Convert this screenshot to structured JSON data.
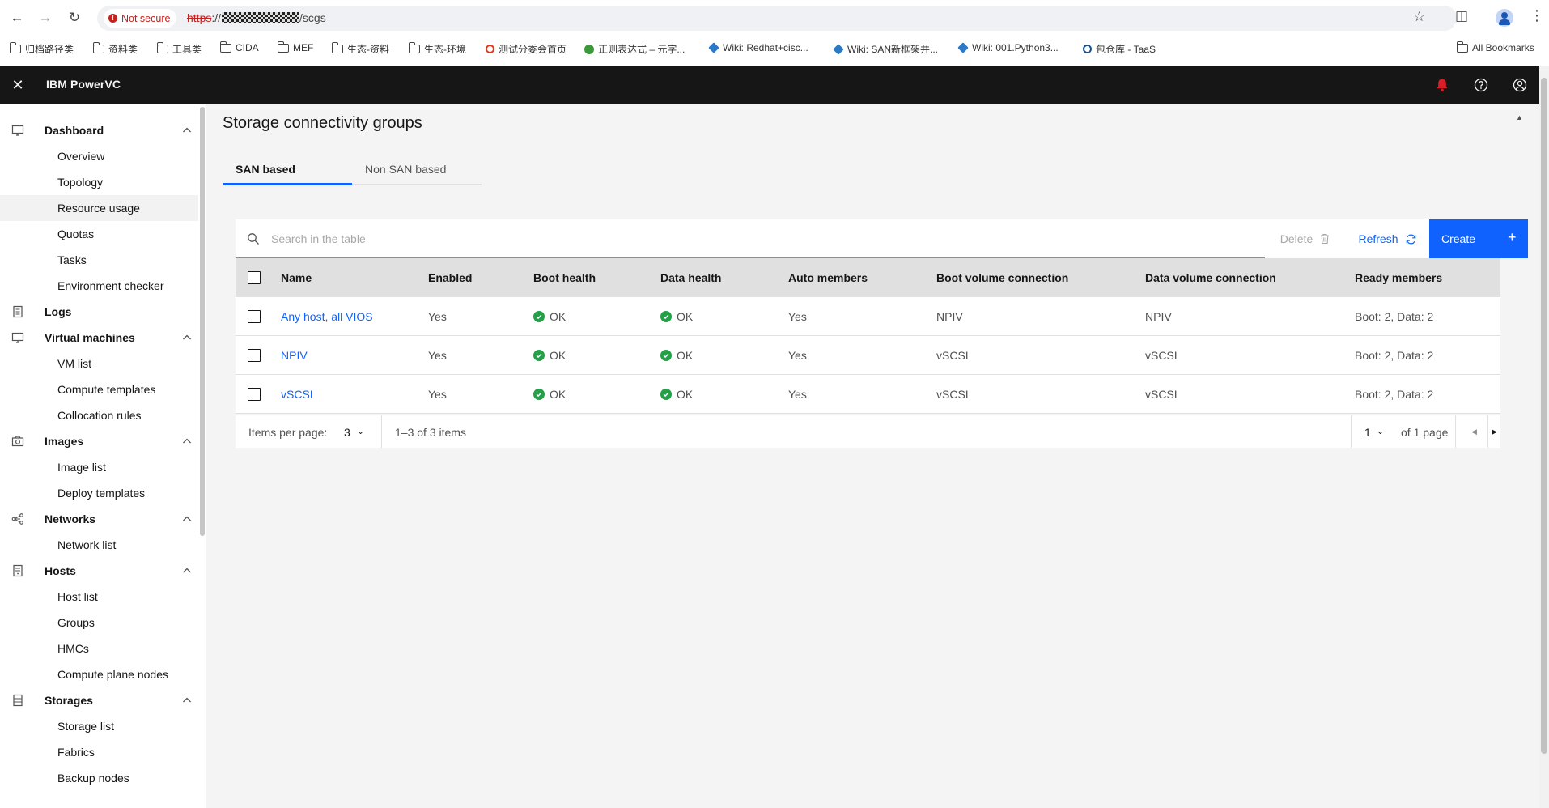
{
  "browser": {
    "not_secure": "Not secure",
    "url_scheme": "https",
    "url_sep": "://",
    "url_path": "/scgs",
    "bookmarks": [
      {
        "label": "归档路径类",
        "type": "folder"
      },
      {
        "label": "资料类",
        "type": "folder"
      },
      {
        "label": "工具类",
        "type": "folder"
      },
      {
        "label": "CIDA",
        "type": "folder"
      },
      {
        "label": "MEF",
        "type": "folder"
      },
      {
        "label": "生态-资料",
        "type": "folder"
      },
      {
        "label": "生态-环境",
        "type": "folder"
      },
      {
        "label": "测试分委会首页",
        "type": "site"
      },
      {
        "label": "正则表达式 – 元字...",
        "type": "site"
      },
      {
        "label": "Wiki: Redhat+cisc...",
        "type": "site"
      },
      {
        "label": "Wiki: SAN新框架并...",
        "type": "site"
      },
      {
        "label": "Wiki: 001.Python3...",
        "type": "site"
      },
      {
        "label": "包仓库 - TaaS",
        "type": "site"
      }
    ],
    "all_bookmarks": "All Bookmarks"
  },
  "header": {
    "product": "IBM PowerVC"
  },
  "sidebar": {
    "groups": [
      {
        "label": "Dashboard",
        "icon": "monitor-icon",
        "items": [
          "Overview",
          "Topology",
          "Resource usage",
          "Quotas",
          "Tasks",
          "Environment checker"
        ]
      },
      {
        "label": "Logs",
        "icon": "log-icon",
        "items": []
      },
      {
        "label": "Virtual machines",
        "icon": "monitor-icon",
        "items": [
          "VM list",
          "Compute templates",
          "Collocation rules"
        ]
      },
      {
        "label": "Images",
        "icon": "camera-icon",
        "items": [
          "Image list",
          "Deploy templates"
        ]
      },
      {
        "label": "Networks",
        "icon": "network-icon",
        "items": [
          "Network list"
        ]
      },
      {
        "label": "Hosts",
        "icon": "server-icon",
        "items": [
          "Host list",
          "Groups",
          "HMCs",
          "Compute plane nodes"
        ]
      },
      {
        "label": "Storages",
        "icon": "storage-icon",
        "items": [
          "Storage list",
          "Fabrics",
          "Backup nodes"
        ]
      }
    ],
    "active_item": "Resource usage"
  },
  "main": {
    "title": "Storage connectivity groups",
    "tabs": [
      {
        "label": "SAN based",
        "selected": true
      },
      {
        "label": "Non SAN based",
        "selected": false
      }
    ],
    "search_placeholder": "Search in the table",
    "delete_label": "Delete",
    "refresh_label": "Refresh",
    "create_label": "Create",
    "columns": [
      "Name",
      "Enabled",
      "Boot health",
      "Data health",
      "Auto members",
      "Boot volume connection",
      "Data volume connection",
      "Ready members"
    ],
    "rows": [
      {
        "name": "Any host, all VIOS",
        "enabled": "Yes",
        "boot_health": "OK",
        "data_health": "OK",
        "auto_members": "Yes",
        "boot_conn": "NPIV",
        "data_conn": "NPIV",
        "ready": "Boot: 2, Data: 2"
      },
      {
        "name": "NPIV",
        "enabled": "Yes",
        "boot_health": "OK",
        "data_health": "OK",
        "auto_members": "Yes",
        "boot_conn": "vSCSI",
        "data_conn": "vSCSI",
        "ready": "Boot: 2, Data: 2"
      },
      {
        "name": "vSCSI",
        "enabled": "Yes",
        "boot_health": "OK",
        "data_health": "OK",
        "auto_members": "Yes",
        "boot_conn": "vSCSI",
        "data_conn": "vSCSI",
        "ready": "Boot: 2, Data: 2"
      }
    ],
    "pagination": {
      "items_per_page_label": "Items per page:",
      "items_per_page": "3",
      "range": "1–3 of 3 items",
      "page": "1",
      "of_pages": "of 1 page"
    }
  },
  "colors": {
    "primary": "#0f62fe",
    "header_bg": "#161616",
    "success": "#24a148",
    "notification": "#da1e28"
  }
}
